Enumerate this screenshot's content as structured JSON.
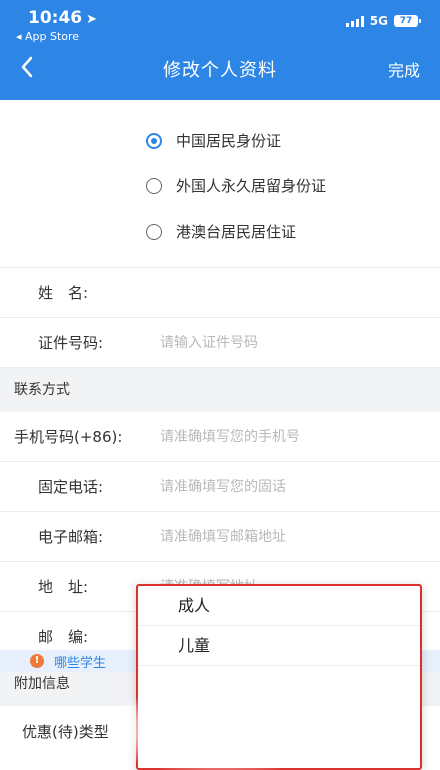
{
  "status_bar": {
    "time": "10:46",
    "back_app": "◂ App Store",
    "network": "5G",
    "battery": "77"
  },
  "nav": {
    "back_icon": "chevron-left-icon",
    "title": "修改个人资料",
    "done_label": "完成"
  },
  "id_types": [
    {
      "label": "中国居民身份证",
      "selected": true
    },
    {
      "label": "外国人永久居留身份证",
      "selected": false
    },
    {
      "label": "港澳台居民居住证",
      "selected": false
    }
  ],
  "fields": {
    "name": {
      "label": "姓　名:",
      "placeholder": ""
    },
    "id_number": {
      "label": "证件号码:",
      "placeholder": "请输入证件号码"
    }
  },
  "contact": {
    "section_title": "联系方式",
    "mobile": {
      "label": "手机号码(+86):",
      "placeholder": "请准确填写您的手机号"
    },
    "phone": {
      "label": "固定电话:",
      "placeholder": "请准确填写您的固话"
    },
    "email": {
      "label": "电子邮箱:",
      "placeholder": "请准确填写邮箱地址"
    },
    "address": {
      "label": "地　址:",
      "placeholder": "请准确填写地址"
    },
    "postcode": {
      "label": "邮　编:",
      "placeholder": ""
    }
  },
  "extra": {
    "section_title": "附加信息",
    "discount_type_label": "优惠(待)类型",
    "notice_text": "哪些学生"
  },
  "popup": {
    "options": [
      "成人",
      "儿童"
    ]
  },
  "colors": {
    "brand": "#2d86e6",
    "highlight_border": "#d9322e"
  }
}
